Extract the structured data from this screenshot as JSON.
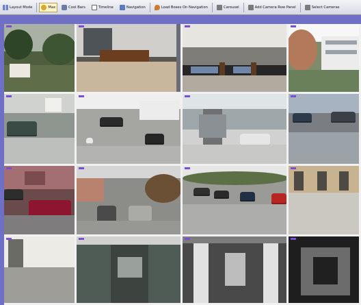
{
  "toolbar": {
    "items": [
      {
        "label": "Layout Mode",
        "icon": "grid-icon",
        "active": false
      },
      {
        "label": "Max",
        "icon": "star-icon",
        "active": true
      },
      {
        "label": "Cool Bars",
        "icon": "camera-icon",
        "active": false
      },
      {
        "label": "Timeline",
        "icon": "plus-icon",
        "active": false
      },
      {
        "label": "Navigation",
        "icon": "cube-icon",
        "active": false
      },
      {
        "label": "Load Boxes On Navigation",
        "icon": "pin-icon",
        "active": false
      },
      {
        "label": "Carousel",
        "icon": "cctv-icon",
        "active": false
      },
      {
        "label": "Add Camera Row Panel",
        "icon": "cctv-icon",
        "active": false
      },
      {
        "label": "Select Cameras",
        "icon": "cctv-icon",
        "active": false
      }
    ]
  },
  "camera_grid": {
    "columns": 4,
    "rows": 4
  }
}
